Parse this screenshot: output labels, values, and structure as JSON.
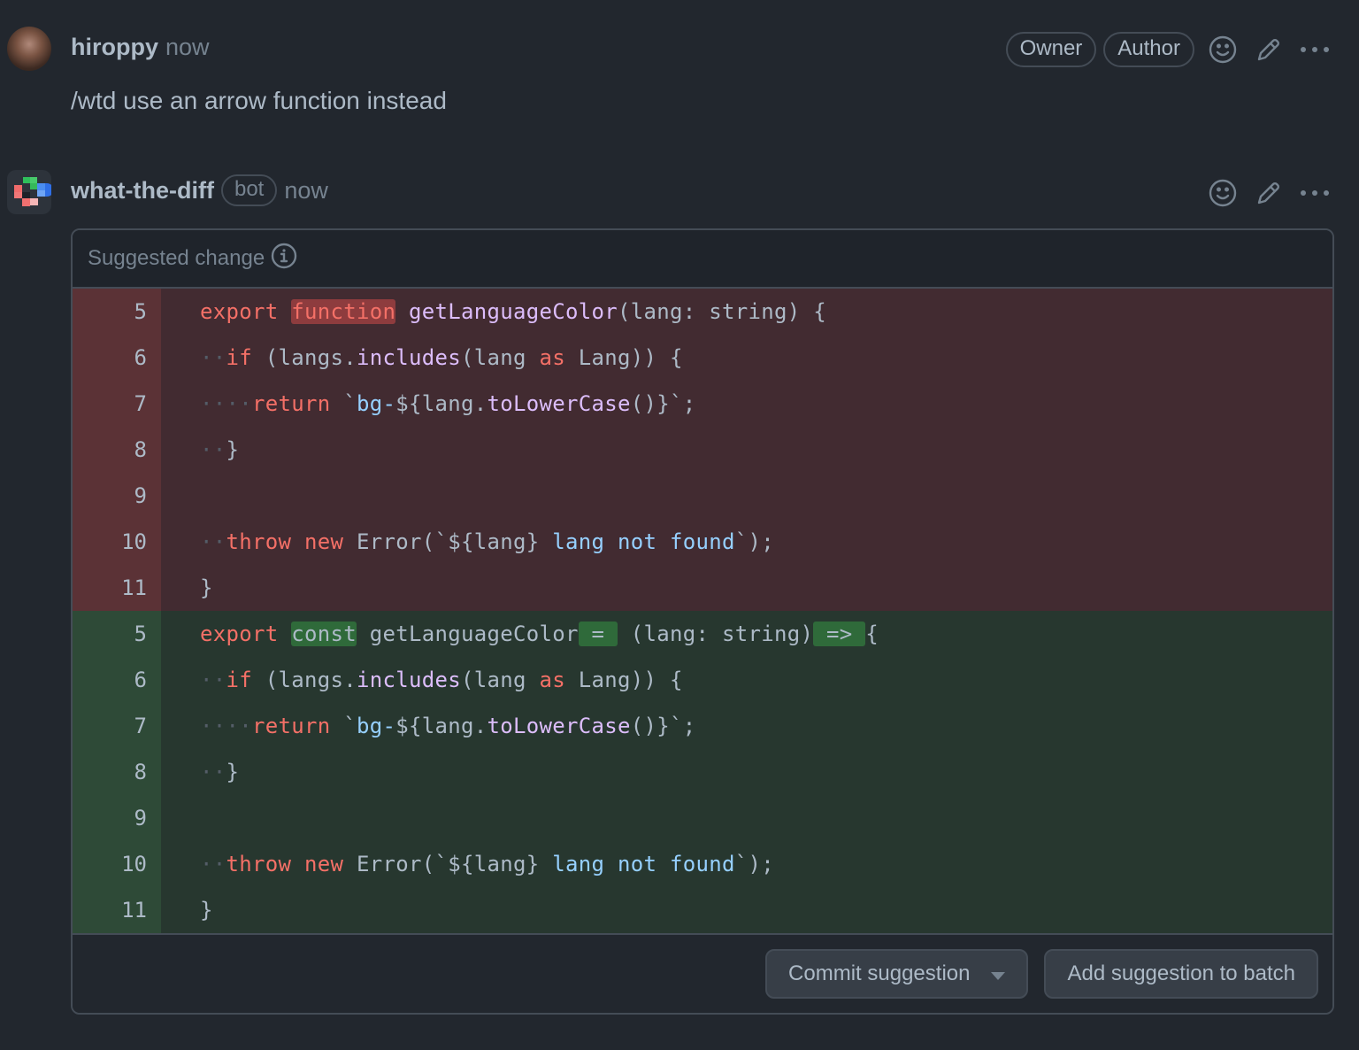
{
  "comments": [
    {
      "author": "hiroppy",
      "timestamp": "now",
      "badges": [
        "Owner",
        "Author"
      ],
      "body": "/wtd use an arrow function instead",
      "icons": [
        "smiley-icon",
        "pencil-icon",
        "kebab-horizontal-icon"
      ]
    },
    {
      "author": "what-the-diff",
      "bot_label": "bot",
      "timestamp": "now",
      "icons": [
        "smiley-icon",
        "pencil-icon",
        "kebab-horizontal-icon"
      ],
      "suggestion": {
        "title": "Suggested change",
        "info_icon": "info-icon",
        "removed_lines": [
          {
            "num": "5",
            "code": "export function getLanguageColor(lang: string) {"
          },
          {
            "num": "6",
            "code": "··if (langs.includes(lang as Lang)) {"
          },
          {
            "num": "7",
            "code": "····return `bg-${lang.toLowerCase()}`;"
          },
          {
            "num": "8",
            "code": "··}"
          },
          {
            "num": "9",
            "code": ""
          },
          {
            "num": "10",
            "code": "··throw new Error(`${lang} lang not found`);"
          },
          {
            "num": "11",
            "code": "}"
          }
        ],
        "added_lines": [
          {
            "num": "5",
            "code": "export const getLanguageColor = (lang: string) => {"
          },
          {
            "num": "6",
            "code": "··if (langs.includes(lang as Lang)) {"
          },
          {
            "num": "7",
            "code": "····return `bg-${lang.toLowerCase()}`;"
          },
          {
            "num": "8",
            "code": "··}"
          },
          {
            "num": "9",
            "code": ""
          },
          {
            "num": "10",
            "code": "··throw new Error(`${lang} lang not found`);"
          },
          {
            "num": "11",
            "code": "}"
          }
        ],
        "commit_button": "Commit suggestion",
        "batch_button": "Add suggestion to batch"
      }
    }
  ],
  "colors": {
    "background": "#22272e",
    "deleted_bg": "#422b31",
    "added_bg": "#27372f",
    "keyword": "#f47067",
    "function": "#dcbdfb",
    "string": "#96d0ff"
  }
}
